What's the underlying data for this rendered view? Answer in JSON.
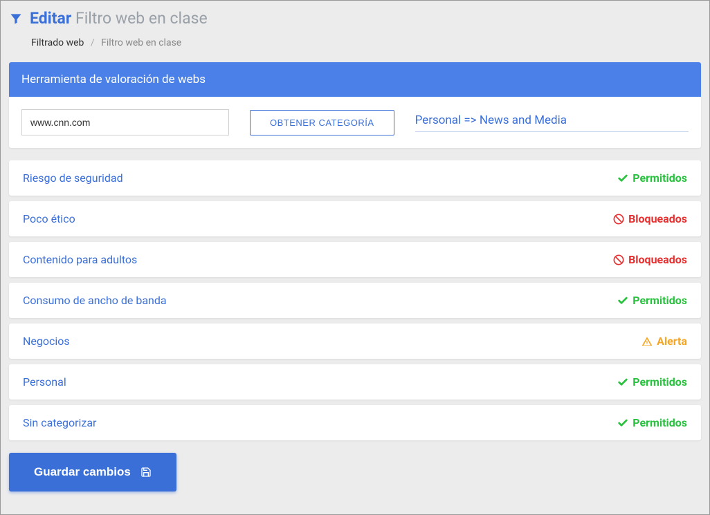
{
  "header": {
    "title_strong": "Editar",
    "title_rest": "Filtro web en clase"
  },
  "breadcrumb": {
    "parent": "Filtrado web",
    "current": "Filtro web en clase"
  },
  "rating_tool": {
    "panel_title": "Herramienta de valoración de webs",
    "url_value": "www.cnn.com",
    "get_category_label": "OBTENER CATEGORÍA",
    "result": "Personal => News and Media"
  },
  "statuses": {
    "permitidos": "Permitidos",
    "bloqueados": "Bloqueados",
    "alerta": "Alerta"
  },
  "categories": [
    {
      "name": "Riesgo de seguridad",
      "status": "permitidos"
    },
    {
      "name": "Poco ético",
      "status": "bloqueados"
    },
    {
      "name": "Contenido para adultos",
      "status": "bloqueados"
    },
    {
      "name": "Consumo de ancho de banda",
      "status": "permitidos"
    },
    {
      "name": "Negocios",
      "status": "alerta"
    },
    {
      "name": "Personal",
      "status": "permitidos"
    },
    {
      "name": "Sin categorizar",
      "status": "permitidos"
    }
  ],
  "actions": {
    "save_label": "Guardar cambios"
  }
}
